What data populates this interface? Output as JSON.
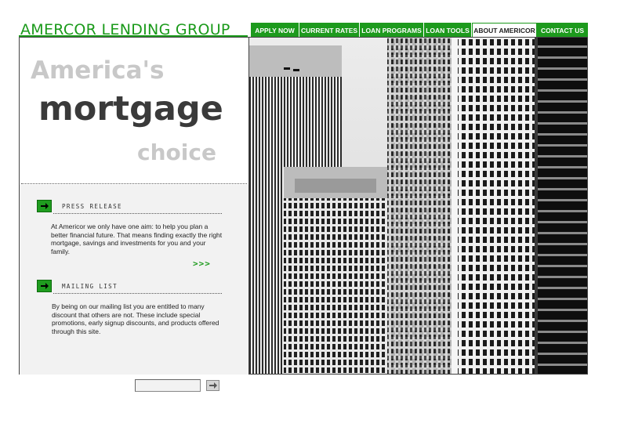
{
  "header": {
    "brand": "AMERCOR LENDING GROUP"
  },
  "nav": {
    "items": [
      {
        "label": "APPLY NOW",
        "active": false
      },
      {
        "label": "CURRENT RATES",
        "active": false
      },
      {
        "label": "LOAN PROGRAMS",
        "active": false
      },
      {
        "label": "LOAN TOOLS",
        "active": false
      },
      {
        "label": "ABOUT AMERICOR",
        "active": true
      },
      {
        "label": "CONTACT US",
        "active": false
      }
    ]
  },
  "hero": {
    "line1": "America's",
    "line2": "mortgage",
    "line3": "choice"
  },
  "press_release": {
    "title": "PRESS RELEASE",
    "body": "At Americor we only have one aim: to help you plan a better financial future. That means finding exactly the right mortgage, savings and investments for you and your family.",
    "more_label": ">>>"
  },
  "mailing_list": {
    "title": "MAILING LIST",
    "body": "By being on our mailing list you are entitled to many discount that others are not. These include special promotions, early signup discounts, and products offered through this site.",
    "input_value": ""
  },
  "colors": {
    "brand_green": "#1a9a1a",
    "nav_green": "#1d9a1d",
    "text_dark": "#3a3a3a",
    "text_light": "#c8c8c8"
  },
  "icons": {
    "section_arrow": "arrow-right-icon",
    "submit": "arrow-right-icon"
  }
}
